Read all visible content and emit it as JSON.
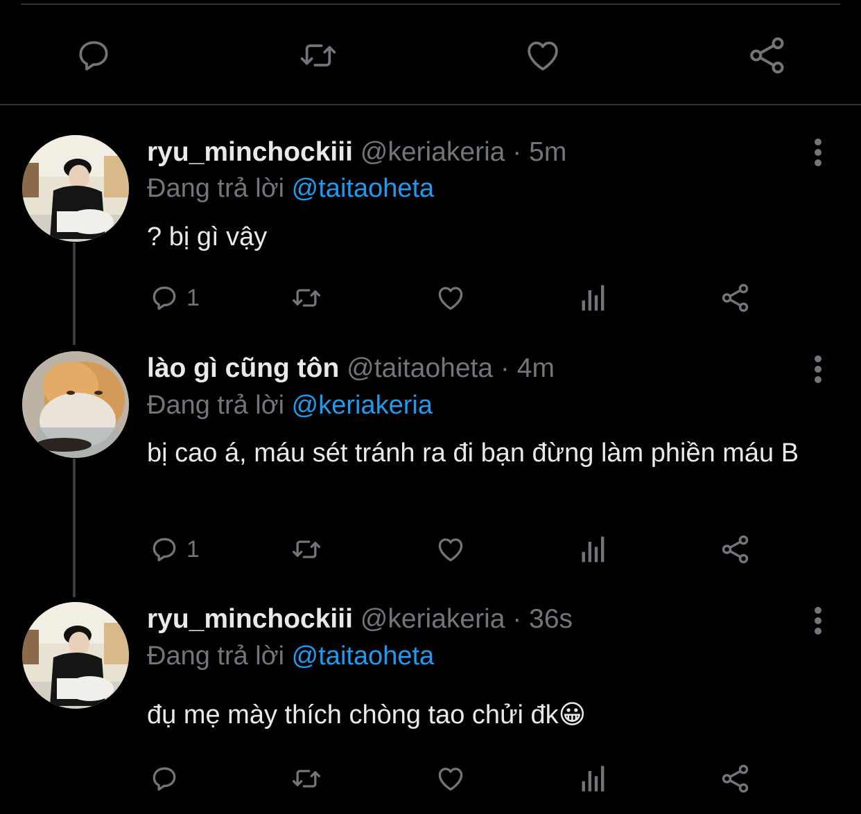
{
  "top_actions": {
    "reply_icon": "reply-icon",
    "retweet_icon": "retweet-icon",
    "like_icon": "heart-icon",
    "share_icon": "share-icon"
  },
  "colors": {
    "background": "#000000",
    "primary_text": "#e7e9ea",
    "secondary_text": "#71767b",
    "mention": "#1d9bf0",
    "divider": "#2f3336"
  },
  "tweets": [
    {
      "display_name": "ryu_minchockiii",
      "handle": "@keriakeria",
      "separator": "·",
      "time": "5m",
      "reply_prefix": "Đang trả lời",
      "reply_to": "@taitaoheta",
      "text": "? bị gì vậy",
      "reply_count": "1"
    },
    {
      "display_name": "lào gì cũng tôn",
      "handle": "@taitaoheta",
      "separator": "·",
      "time": "4m",
      "reply_prefix": "Đang trả lời",
      "reply_to": "@keriakeria",
      "text": "bị cao á, máu sét tránh ra đi bạn đừng làm phiền máu B",
      "reply_count": "1"
    },
    {
      "display_name": "ryu_minchockiii",
      "handle": "@keriakeria",
      "separator": "·",
      "time": "36s",
      "reply_prefix": "Đang trả lời",
      "reply_to": "@taitaoheta",
      "text": "đụ mẹ mày thích chòng tao chửi đk😀",
      "reply_count": ""
    }
  ]
}
